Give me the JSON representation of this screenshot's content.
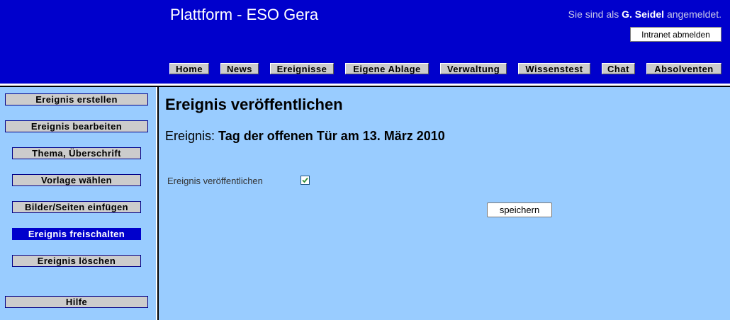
{
  "header": {
    "title": "Plattform - ESO Gera",
    "login_prefix": "Sie sind als",
    "login_user": "G. Seidel",
    "login_suffix": "angemeldet.",
    "logout_label": "Intranet abmelden"
  },
  "nav": {
    "items": [
      {
        "label": "Home"
      },
      {
        "label": "News"
      },
      {
        "label": "Ereignisse"
      },
      {
        "label": "Eigene Ablage"
      },
      {
        "label": "Verwaltung"
      },
      {
        "label": "Wissenstest"
      },
      {
        "label": "Chat"
      },
      {
        "label": "Absolventen"
      }
    ]
  },
  "sidebar": {
    "items": [
      {
        "label": "Ereignis erstellen"
      },
      {
        "label": "Ereignis bearbeiten"
      },
      {
        "label": "Thema, Überschrift"
      },
      {
        "label": "Vorlage wählen"
      },
      {
        "label": "Bilder/Seiten einfügen"
      },
      {
        "label": "Ereignis freischalten"
      },
      {
        "label": "Ereignis löschen"
      },
      {
        "label": "Hilfe"
      }
    ],
    "active_index": 5
  },
  "main": {
    "title": "Ereignis veröffentlichen",
    "event_prefix": "Ereignis:",
    "event_name": "Tag der offenen Tür am 13. März 2010",
    "publish_label": "Ereignis veröffentlichen",
    "publish_checked": true,
    "save_label": "speichern"
  },
  "colors": {
    "header_bg": "#0000cc",
    "content_bg": "#99ccff",
    "button_gray": "#cccccc",
    "active_bg": "#0000cc",
    "checkmark": "#2e8b2e"
  }
}
